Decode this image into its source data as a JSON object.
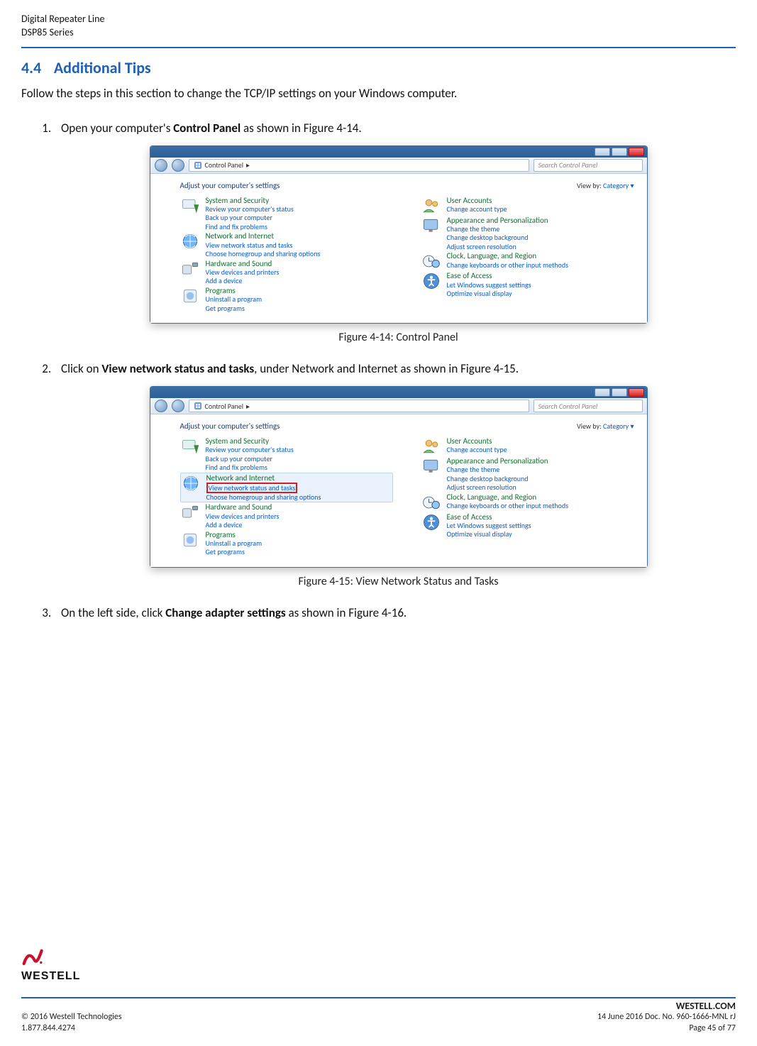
{
  "header": {
    "line1": "Digital Repeater Line",
    "line2": "DSP85 Series"
  },
  "section": {
    "number": "4.4",
    "title": "Additional Tips",
    "intro": "Follow the steps in this section to change the TCP/IP settings on your Windows computer."
  },
  "steps": {
    "s1_pre": "Open your computer's ",
    "s1_bold": "Control Panel",
    "s1_post": " as shown in Figure 4-14.",
    "s2_pre": "Click on ",
    "s2_bold": "View network status and tasks",
    "s2_post": ", under Network and Internet as shown in Figure 4-15.",
    "s3_pre": "On the left side, click ",
    "s3_bold": "Change adapter settings",
    "s3_post": " as shown in Figure 4-16."
  },
  "figures": {
    "f14": "Figure 4-14: Control Panel",
    "f15": "Figure 4-15: View Network Status and Tasks"
  },
  "cp": {
    "breadcrumb_icon_name": "control-panel-icon",
    "breadcrumb": "Control Panel",
    "breadcrumb_sep": "▸",
    "search_placeholder": "Search Control Panel",
    "adjust": "Adjust your computer's settings",
    "viewby_label": "View by:",
    "viewby_value": "Category ▾",
    "left": [
      {
        "head": "System and Security",
        "subs": [
          "Review your computer's status",
          "Back up your computer",
          "Find and fix problems"
        ]
      },
      {
        "head": "Network and Internet",
        "subs": [
          "View network status and tasks",
          "Choose homegroup and sharing options"
        ]
      },
      {
        "head": "Hardware and Sound",
        "subs": [
          "View devices and printers",
          "Add a device"
        ]
      },
      {
        "head": "Programs",
        "subs": [
          "Uninstall a program",
          "Get programs"
        ]
      }
    ],
    "right": [
      {
        "head": "User Accounts",
        "subs": [
          "Change account type"
        ]
      },
      {
        "head": "Appearance and Personalization",
        "subs": [
          "Change the theme",
          "Change desktop background",
          "Adjust screen resolution"
        ]
      },
      {
        "head": "Clock, Language, and Region",
        "subs": [
          "Change keyboards or other input methods"
        ]
      },
      {
        "head": "Ease of Access",
        "subs": [
          "Let Windows suggest settings",
          "Optimize visual display"
        ]
      }
    ]
  },
  "footer": {
    "logo_text": "WESTELL",
    "brand": "WESTELL.COM",
    "copyright": "© 2016 Westell Technologies",
    "docline": "14 June 2016 Doc. No. 960-1666-MNL rJ",
    "phone": "1.877.844.4274",
    "page": "Page 45 of 77"
  }
}
